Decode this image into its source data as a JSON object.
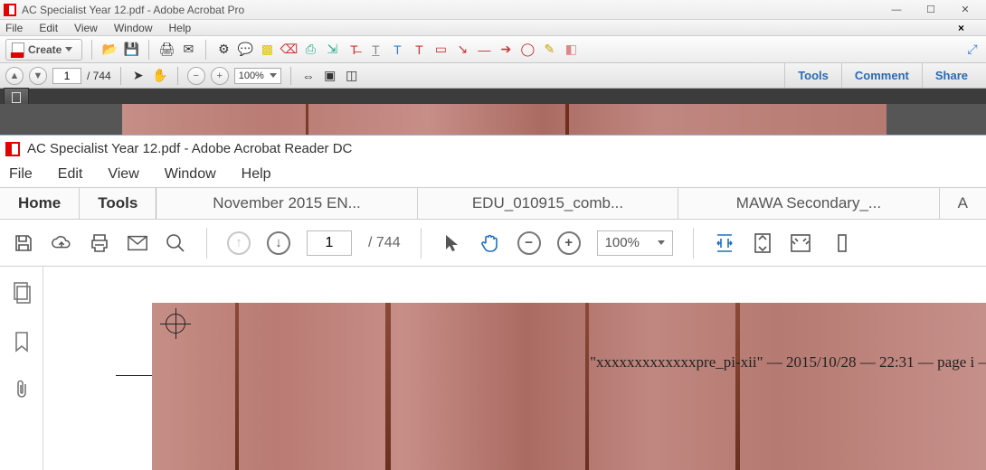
{
  "pro": {
    "title": "AC Specialist Year 12.pdf - Adobe Acrobat Pro",
    "menu": {
      "file": "File",
      "edit": "Edit",
      "view": "View",
      "window": "Window",
      "help": "Help"
    },
    "create": "Create",
    "page_current": "1",
    "page_total": "/  744",
    "zoom": "100%",
    "tools": "Tools",
    "comment": "Comment",
    "share": "Share"
  },
  "dc": {
    "title": "AC Specialist Year 12.pdf - Adobe Acrobat Reader DC",
    "menu": {
      "file": "File",
      "edit": "Edit",
      "view": "View",
      "window": "Window",
      "help": "Help"
    },
    "tabs": {
      "home": "Home",
      "tools": "Tools",
      "doc1": "November 2015 EN...",
      "doc2": "EDU_010915_comb...",
      "doc3": "MAWA Secondary_...",
      "doc4": "A"
    },
    "page_current": "1",
    "page_total": "/  744",
    "zoom": "100%",
    "footer_text": "\"xxxxxxxxxxxxxpre_pi-xii\"  —  2015/10/28  —  22:31  —  page  i  –"
  }
}
